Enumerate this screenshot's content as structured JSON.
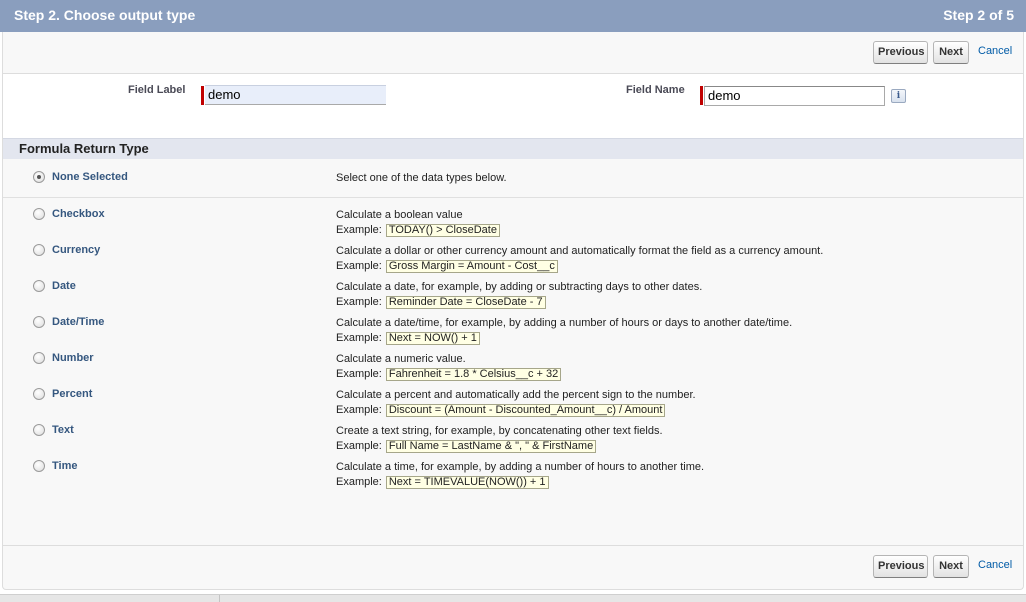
{
  "header": {
    "title": "Step 2. Choose output type",
    "step": "Step 2 of 5"
  },
  "buttons": {
    "previous": "Previous",
    "next": "Next",
    "cancel": "Cancel"
  },
  "fields": {
    "field_label": {
      "label": "Field Label",
      "value": "demo"
    },
    "field_name": {
      "label": "Field Name",
      "value": "demo"
    },
    "info_icon": "i"
  },
  "section": {
    "title": "Formula Return Type"
  },
  "options": [
    {
      "label": "None Selected",
      "description": "Select one of the data types below.",
      "example_prefix": "",
      "example": "",
      "selected": true
    },
    {
      "label": "Checkbox",
      "description": "Calculate a boolean value",
      "example_prefix": "Example:",
      "example": "TODAY() > CloseDate",
      "selected": false
    },
    {
      "label": "Currency",
      "description": "Calculate a dollar or other currency amount and automatically format the field as a currency amount.",
      "example_prefix": "Example:",
      "example": "Gross Margin = Amount - Cost__c",
      "selected": false
    },
    {
      "label": "Date",
      "description": "Calculate a date, for example, by adding or subtracting days to other dates.",
      "example_prefix": "Example:",
      "example": "Reminder Date = CloseDate - 7",
      "selected": false
    },
    {
      "label": "Date/Time",
      "description": "Calculate a date/time, for example, by adding a number of hours or days to another date/time.",
      "example_prefix": "Example:",
      "example": "Next = NOW() + 1",
      "selected": false
    },
    {
      "label": "Number",
      "description": "Calculate a numeric value.",
      "example_prefix": "Example:",
      "example": "Fahrenheit = 1.8 * Celsius__c + 32",
      "selected": false
    },
    {
      "label": "Percent",
      "description": "Calculate a percent and automatically add the percent sign to the number.",
      "example_prefix": "Example:",
      "example": "Discount = (Amount - Discounted_Amount__c) / Amount",
      "selected": false
    },
    {
      "label": "Text",
      "description": "Create a text string, for example, by concatenating other text fields.",
      "example_prefix": "Example:",
      "example": "Full Name = LastName & \", \" & FirstName",
      "selected": false
    },
    {
      "label": "Time",
      "description": "Calculate a time, for example, by adding a number of hours to another time.",
      "example_prefix": "Example:",
      "example": "Next = TIMEVALUE(NOW()) + 1",
      "selected": false
    }
  ],
  "colors": {
    "header_bg": "#8a9ebe",
    "option_label": "#35577f",
    "link": "#015ba7",
    "required": "#c00000"
  }
}
